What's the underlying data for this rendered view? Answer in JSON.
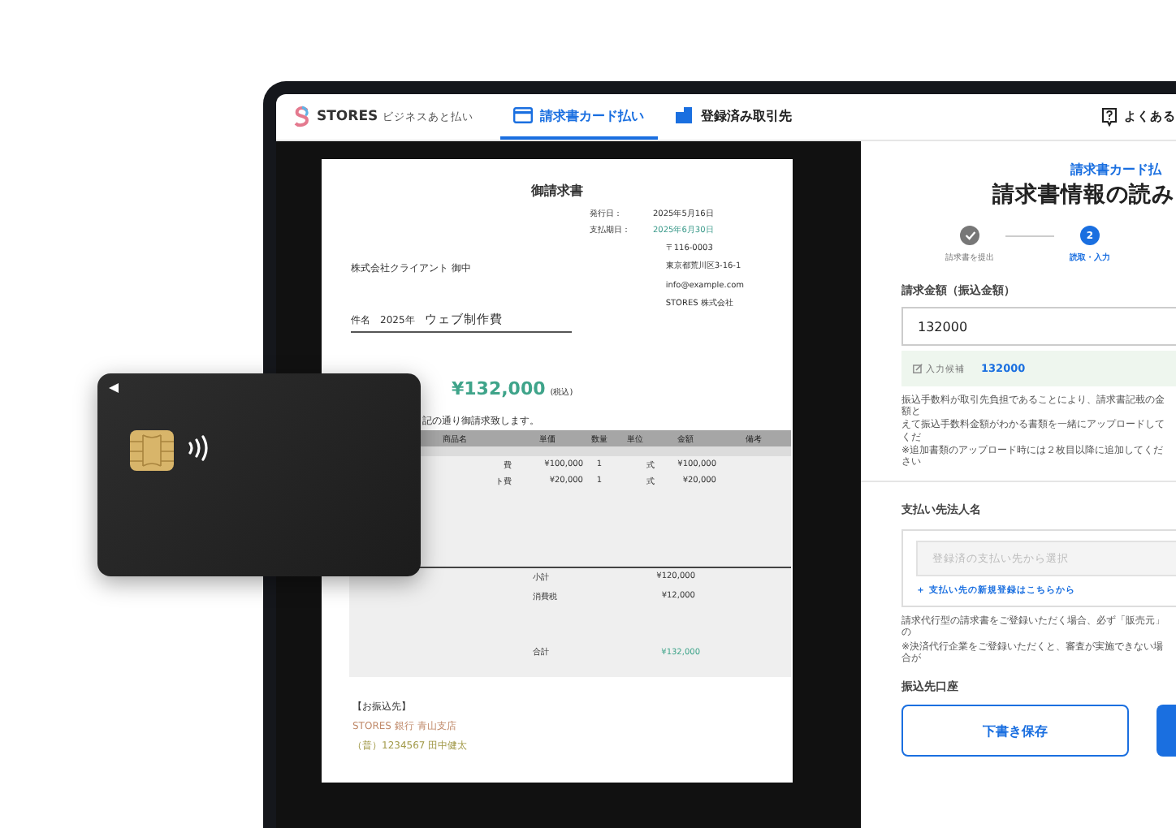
{
  "header": {
    "logo": {
      "name": "STORES",
      "tagline": "ビジネスあと払い"
    },
    "tabs": [
      {
        "label": "請求書カード払い",
        "selected": true,
        "kind": "card"
      },
      {
        "label": "登録済み取引先",
        "selected": false,
        "kind": "buildings"
      }
    ],
    "help": "よくある"
  },
  "invoice": {
    "title": "御請求書",
    "meta": [
      {
        "label": "発行日：",
        "value": "2025年5月16日",
        "kind": "plain"
      },
      {
        "label": "支払期日：",
        "value": "2025年6月30日",
        "kind": "accent"
      }
    ],
    "client": "株式会社クライアント 御中",
    "sender": [
      "〒116-0003",
      "東京都荒川区3-16-1",
      "info@example.com",
      "STORES 株式会社"
    ],
    "subject_label": "件名",
    "subject_year": "2025年",
    "subject": "ウェブ制作費",
    "total": "¥132,000",
    "tax_note": "(税込)",
    "intro": "記の通り御請求致します。",
    "columns": [
      "商品名",
      "単価",
      "数量",
      "単位",
      "金額",
      "備考"
    ],
    "rows": [
      {
        "item": "費",
        "unit_price": "¥100,000",
        "qty": "1",
        "unit": "式",
        "amount": "¥100,000"
      },
      {
        "item": "ト費",
        "unit_price": "¥20,000",
        "qty": "1",
        "unit": "式",
        "amount": "¥20,000"
      }
    ],
    "sums": [
      {
        "label": "小計",
        "value": "¥120,000",
        "kind": "plain"
      },
      {
        "label": "消費税",
        "value": "¥12,000",
        "kind": "plain"
      },
      {
        "label": "合計",
        "value": "¥132,000",
        "kind": "total"
      }
    ],
    "bank": {
      "heading": "【お振込先】",
      "lines": [
        "STORES 銀行 青山支店",
        "（普）1234567 田中健太"
      ]
    }
  },
  "form": {
    "eyebrow": "請求書カード払",
    "title": "請求書情報の読み",
    "steps": [
      {
        "label": "請求書を提出",
        "completed": true,
        "active": false
      },
      {
        "number": "2",
        "label": "読取・入力",
        "completed": false,
        "active": true
      }
    ],
    "amount": {
      "label": "請求金額（振込金額）",
      "value": "132000",
      "suggestion_label": "入力候補",
      "suggestion": "132000",
      "notes": [
        "振込手数料が取引先負担であることにより、請求書記載の金額と",
        "えて振込手数料金額がわかる書類を一緒にアップロードしてくだ",
        "※追加書類のアップロード時には２枚目以降に追加してください"
      ]
    },
    "payee": {
      "label": "支払い先法人名",
      "placeholder": "登録済の支払い先から選択",
      "link": "＋ 支払い先の新規登録はこちらから",
      "notes": [
        "請求代行型の請求書をご登録いただく場合、必ず「販売元」の",
        "※決済代行企業をご登録いただくと、審査が実施できない場合が"
      ]
    },
    "account_label": "振込先口座",
    "buttons": [
      {
        "label": "下書き保存",
        "kind": "secondary"
      },
      {
        "kind": "primary"
      }
    ]
  }
}
